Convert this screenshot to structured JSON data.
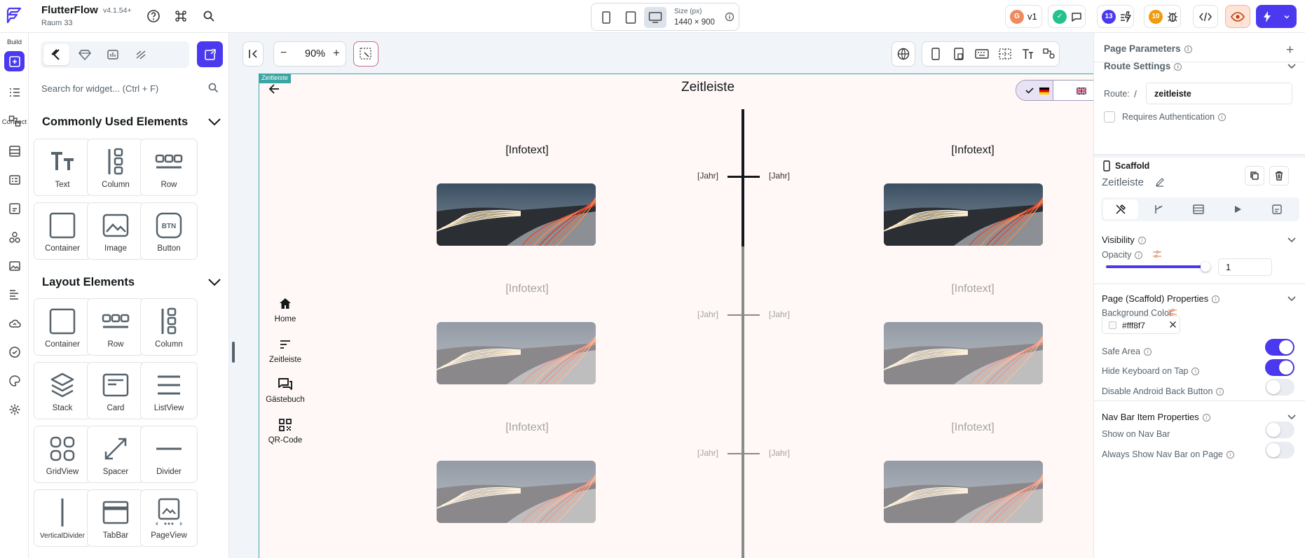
{
  "app": {
    "name": "FlutterFlow",
    "version": "v4.1.54+",
    "project": "Raum 33"
  },
  "toolbar": {
    "size_label": "Size (px)",
    "size_value": "1440 × 900",
    "version_badge": "v1",
    "collab_count_1": "13",
    "collab_count_2": "10"
  },
  "left_rail": {
    "build_label": "Build",
    "connect_label": "Connect"
  },
  "widget_panel": {
    "search_placeholder": "Search for widget... (Ctrl + F)",
    "common_title": "Commonly Used Elements",
    "common": [
      {
        "label": "Text",
        "icon": "text-icon"
      },
      {
        "label": "Column",
        "icon": "column-icon"
      },
      {
        "label": "Row",
        "icon": "row-icon"
      },
      {
        "label": "Container",
        "icon": "container-icon"
      },
      {
        "label": "Image",
        "icon": "image-icon"
      },
      {
        "label": "Button",
        "icon": "button-icon"
      }
    ],
    "layout_title": "Layout Elements",
    "layout": [
      {
        "label": "Container",
        "icon": "container-icon"
      },
      {
        "label": "Row",
        "icon": "row-icon"
      },
      {
        "label": "Column",
        "icon": "column-icon"
      },
      {
        "label": "Stack",
        "icon": "stack-icon"
      },
      {
        "label": "Card",
        "icon": "card-icon"
      },
      {
        "label": "ListView",
        "icon": "listview-icon"
      },
      {
        "label": "GridView",
        "icon": "gridview-icon"
      },
      {
        "label": "Spacer",
        "icon": "spacer-icon"
      },
      {
        "label": "Divider",
        "icon": "divider-icon"
      },
      {
        "label": "VerticalDivider",
        "icon": "vertical-divider-icon"
      },
      {
        "label": "TabBar",
        "icon": "tabbar-icon"
      },
      {
        "label": "PageView",
        "icon": "pageview-icon"
      }
    ]
  },
  "canvas": {
    "zoom": "90%",
    "frame_tag": "Zeitleiste",
    "page_title": "Zeitleiste",
    "background": "#fff8f7",
    "nav": [
      {
        "label": "Home",
        "icon": "home-icon"
      },
      {
        "label": "Zeitleiste",
        "icon": "sort-icon"
      },
      {
        "label": "Gästebuch",
        "icon": "forum-icon"
      },
      {
        "label": "QR-Code",
        "icon": "qr-code-icon"
      }
    ],
    "timeline": [
      {
        "left_text": "[Infotext]",
        "right_text": "[Infotext]",
        "left_year": "[Jahr]",
        "right_year": "[Jahr]"
      },
      {
        "left_text": "[Infotext]",
        "right_text": "[Infotext]",
        "left_year": "[Jahr]",
        "right_year": "[Jahr]"
      },
      {
        "left_text": "[Infotext]",
        "right_text": "[Infotext]",
        "left_year": "[Jahr]",
        "right_year": "[Jahr]"
      }
    ]
  },
  "properties": {
    "page_parameters": "Page Parameters",
    "route_settings": "Route Settings",
    "route_label": "Route:",
    "route_slash": "/",
    "route_value": "zeitleiste",
    "requires_auth": "Requires Authentication",
    "widget_type": "Scaffold",
    "widget_name": "Zeitleiste",
    "visibility": "Visibility",
    "opacity_label": "Opacity",
    "opacity_value": "1",
    "opacity_level": 1,
    "scaffold_props": "Page (Scaffold) Properties",
    "bg_label": "Background Color",
    "bg_value": "#fff8f7",
    "safe_area": "Safe Area",
    "safe_area_on": true,
    "hide_keyboard": "Hide Keyboard on Tap",
    "hide_keyboard_on": true,
    "disable_back": "Disable Android Back Button",
    "disable_back_on": false,
    "navbar_props": "Nav Bar Item Properties",
    "show_navbar": "Show on Nav Bar",
    "show_navbar_on": false,
    "always_show_navbar": "Always Show Nav Bar on Page",
    "always_show_navbar_on": false
  },
  "colors": {
    "accent": "#4b39ef",
    "teal": "#39a6a3",
    "orange": "#ee8b60",
    "green": "#24c38b"
  }
}
